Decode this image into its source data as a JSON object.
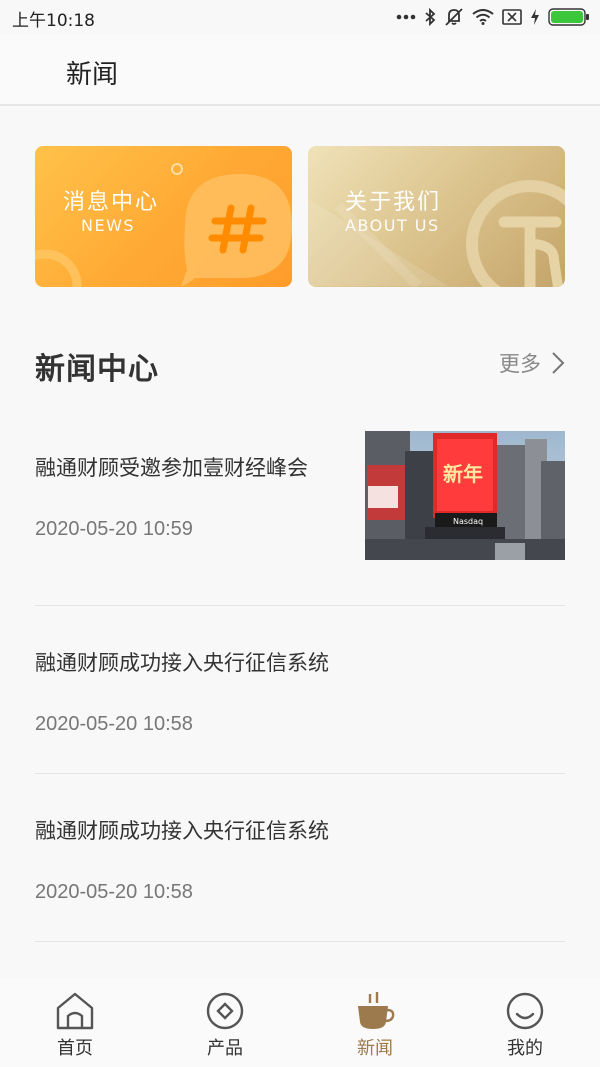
{
  "status_bar": {
    "time": "上午10:18",
    "icons": [
      "more-dots-icon",
      "bluetooth-icon",
      "mute-icon",
      "wifi-icon",
      "sim-off-icon",
      "charging-icon",
      "battery-icon"
    ]
  },
  "header": {
    "title": "新闻"
  },
  "cards": [
    {
      "title": "消息中心",
      "subtitle": "NEWS",
      "icon": "hashtag-bubble-icon",
      "color": "#ffa934"
    },
    {
      "title": "关于我们",
      "subtitle": "ABOUT US",
      "icon": "brand-logo-icon",
      "color": "#d9c089"
    }
  ],
  "section": {
    "title": "新闻中心",
    "more_label": "更多"
  },
  "news": [
    {
      "title": "融通财顾受邀参加壹财经峰会",
      "date": "2020-05-20 10:59",
      "has_image": true
    },
    {
      "title": "融通财顾成功接入央行征信系统",
      "date": "2020-05-20 10:58",
      "has_image": false
    },
    {
      "title": "融通财顾成功接入央行征信系统",
      "date": "2020-05-20 10:58",
      "has_image": false
    }
  ],
  "tabs": [
    {
      "label": "首页",
      "icon": "home-icon",
      "active": false
    },
    {
      "label": "产品",
      "icon": "product-icon",
      "active": false
    },
    {
      "label": "新闻",
      "icon": "coffee-cup-icon",
      "active": true
    },
    {
      "label": "我的",
      "icon": "smiley-icon",
      "active": false
    }
  ],
  "colors": {
    "accent": "#9c7a4e",
    "news_card": "#ffa934",
    "about_card": "#d9c089"
  }
}
